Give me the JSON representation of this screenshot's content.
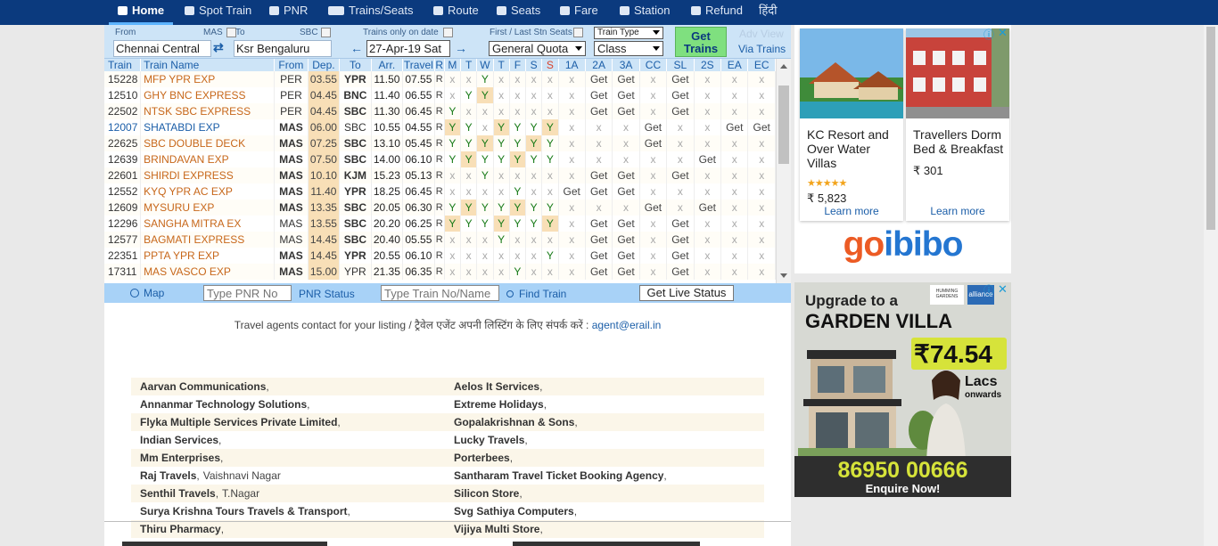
{
  "nav": {
    "items": [
      {
        "label": "Home",
        "icon": "home-icon"
      },
      {
        "label": "Spot Train",
        "icon": "train-icon"
      },
      {
        "label": "PNR",
        "icon": "pnr-icon"
      },
      {
        "label": "Trains/Seats",
        "icon": "seats-icon"
      },
      {
        "label": "Route",
        "icon": "route-icon"
      },
      {
        "label": "Seats",
        "icon": "people-icon"
      },
      {
        "label": "Fare",
        "icon": "tag-icon"
      },
      {
        "label": "Station",
        "icon": "station-icon"
      },
      {
        "label": "Refund",
        "icon": "refund-icon"
      },
      {
        "label": "हिंदी",
        "icon": ""
      }
    ],
    "active": "Home"
  },
  "search": {
    "from_label": "From",
    "from_mas": "MAS",
    "from_value": "Chennai Central",
    "to_label": "To",
    "to_sbc": "SBC",
    "to_value": "Ksr Bengaluru",
    "date_label": "Trains only on date",
    "date_value": "27-Apr-19 Sat",
    "quota_label": "First / Last Stn Seats",
    "quota_value": "General Quota",
    "train_type": "Train Type",
    "class_value": "Class",
    "get_trains": "Get Trains",
    "adv_view": "Adv View",
    "via_trains": "Via Trains"
  },
  "table": {
    "headers": [
      "Train",
      "Train Name",
      "From",
      "Dep.",
      "To",
      "Arr.",
      "Travel",
      "R",
      "M",
      "T",
      "W",
      "T",
      "F",
      "S",
      "S",
      "1A",
      "2A",
      "3A",
      "CC",
      "SL",
      "2S",
      "EA",
      "EC"
    ],
    "rows": [
      {
        "no": "15228",
        "name": "MFP YPR EXP",
        "from": "PER",
        "dep": "03.55",
        "to": "YPR",
        "arr": "11.50",
        "travel": "07.55",
        "r": "R",
        "days": [
          "x",
          "x",
          "Y",
          "x",
          "x",
          "x",
          "x"
        ],
        "cls": [
          "x",
          "Get",
          "Get",
          "x",
          "Get",
          "x",
          "x",
          "x"
        ],
        "blue": false,
        "fromBold": false,
        "toBold": true
      },
      {
        "no": "12510",
        "name": "GHY BNC EXPRESS",
        "from": "PER",
        "dep": "04.45",
        "to": "BNC",
        "arr": "11.40",
        "travel": "06.55",
        "r": "R",
        "days": [
          "x",
          "Y",
          "Y",
          "x",
          "x",
          "x",
          "x"
        ],
        "cls": [
          "x",
          "Get",
          "Get",
          "x",
          "Get",
          "x",
          "x",
          "x"
        ],
        "blue": false,
        "fromBold": false,
        "toBold": true
      },
      {
        "no": "22502",
        "name": "NTSK SBC EXPRESS",
        "from": "PER",
        "dep": "04.45",
        "to": "SBC",
        "arr": "11.30",
        "travel": "06.45",
        "r": "R",
        "days": [
          "Y",
          "x",
          "x",
          "x",
          "x",
          "x",
          "x"
        ],
        "cls": [
          "x",
          "Get",
          "Get",
          "x",
          "Get",
          "x",
          "x",
          "x"
        ],
        "blue": false,
        "fromBold": false,
        "toBold": true
      },
      {
        "no": "12007",
        "name": "SHATABDI EXP",
        "from": "MAS",
        "dep": "06.00",
        "to": "SBC",
        "arr": "10.55",
        "travel": "04.55",
        "r": "R",
        "days": [
          "Y",
          "Y",
          "x",
          "Y",
          "Y",
          "Y",
          "Y"
        ],
        "cls": [
          "x",
          "x",
          "x",
          "Get",
          "x",
          "x",
          "Get",
          "Get"
        ],
        "blue": true,
        "fromBold": true,
        "toBold": false
      },
      {
        "no": "22625",
        "name": "SBC DOUBLE DECK",
        "from": "MAS",
        "dep": "07.25",
        "to": "SBC",
        "arr": "13.10",
        "travel": "05.45",
        "r": "R",
        "days": [
          "Y",
          "Y",
          "Y",
          "Y",
          "Y",
          "Y",
          "Y"
        ],
        "cls": [
          "x",
          "x",
          "x",
          "Get",
          "x",
          "x",
          "x",
          "x"
        ],
        "blue": false,
        "fromBold": true,
        "toBold": true
      },
      {
        "no": "12639",
        "name": "BRINDAVAN EXP",
        "from": "MAS",
        "dep": "07.50",
        "to": "SBC",
        "arr": "14.00",
        "travel": "06.10",
        "r": "R",
        "days": [
          "Y",
          "Y",
          "Y",
          "Y",
          "Y",
          "Y",
          "Y"
        ],
        "cls": [
          "x",
          "x",
          "x",
          "x",
          "x",
          "Get",
          "x",
          "x"
        ],
        "blue": false,
        "fromBold": true,
        "toBold": true
      },
      {
        "no": "22601",
        "name": "SHIRDI EXPRESS",
        "from": "MAS",
        "dep": "10.10",
        "to": "KJM",
        "arr": "15.23",
        "travel": "05.13",
        "r": "R",
        "days": [
          "x",
          "x",
          "Y",
          "x",
          "x",
          "x",
          "x"
        ],
        "cls": [
          "x",
          "Get",
          "Get",
          "x",
          "Get",
          "x",
          "x",
          "x"
        ],
        "blue": false,
        "fromBold": true,
        "toBold": true
      },
      {
        "no": "12552",
        "name": "KYQ YPR AC EXP",
        "from": "MAS",
        "dep": "11.40",
        "to": "YPR",
        "arr": "18.25",
        "travel": "06.45",
        "r": "R",
        "days": [
          "x",
          "x",
          "x",
          "x",
          "Y",
          "x",
          "x"
        ],
        "cls": [
          "Get",
          "Get",
          "Get",
          "x",
          "x",
          "x",
          "x",
          "x"
        ],
        "blue": false,
        "fromBold": true,
        "toBold": true
      },
      {
        "no": "12609",
        "name": "MYSURU EXP",
        "from": "MAS",
        "dep": "13.35",
        "to": "SBC",
        "arr": "20.05",
        "travel": "06.30",
        "r": "R",
        "days": [
          "Y",
          "Y",
          "Y",
          "Y",
          "Y",
          "Y",
          "Y"
        ],
        "cls": [
          "x",
          "x",
          "x",
          "Get",
          "x",
          "Get",
          "x",
          "x"
        ],
        "blue": false,
        "fromBold": true,
        "toBold": true
      },
      {
        "no": "12296",
        "name": "SANGHA MITRA EX",
        "from": "MAS",
        "dep": "13.55",
        "to": "SBC",
        "arr": "20.20",
        "travel": "06.25",
        "r": "R",
        "days": [
          "Y",
          "Y",
          "Y",
          "Y",
          "Y",
          "Y",
          "Y"
        ],
        "cls": [
          "x",
          "Get",
          "Get",
          "x",
          "Get",
          "x",
          "x",
          "x"
        ],
        "blue": false,
        "fromBold": false,
        "toBold": true
      },
      {
        "no": "12577",
        "name": "BAGMATI EXPRESS",
        "from": "MAS",
        "dep": "14.45",
        "to": "SBC",
        "arr": "20.40",
        "travel": "05.55",
        "r": "R",
        "days": [
          "x",
          "x",
          "x",
          "Y",
          "x",
          "x",
          "x"
        ],
        "cls": [
          "x",
          "Get",
          "Get",
          "x",
          "Get",
          "x",
          "x",
          "x"
        ],
        "blue": false,
        "fromBold": false,
        "toBold": true
      },
      {
        "no": "22351",
        "name": "PPTA YPR EXP",
        "from": "MAS",
        "dep": "14.45",
        "to": "YPR",
        "arr": "20.55",
        "travel": "06.10",
        "r": "R",
        "days": [
          "x",
          "x",
          "x",
          "x",
          "x",
          "x",
          "Y"
        ],
        "cls": [
          "x",
          "Get",
          "Get",
          "x",
          "Get",
          "x",
          "x",
          "x"
        ],
        "blue": false,
        "fromBold": true,
        "toBold": true
      },
      {
        "no": "17311",
        "name": "MAS VASCO EXP",
        "from": "MAS",
        "dep": "15.00",
        "to": "YPR",
        "arr": "21.35",
        "travel": "06.35",
        "r": "R",
        "days": [
          "x",
          "x",
          "x",
          "x",
          "Y",
          "x",
          "x"
        ],
        "cls": [
          "x",
          "Get",
          "Get",
          "x",
          "Get",
          "x",
          "x",
          "x"
        ],
        "blue": false,
        "fromBold": true,
        "toBold": false
      }
    ]
  },
  "bar2": {
    "map": "Map",
    "pnr_placeholder": "Type PNR No",
    "pnr_status": "PNR Status",
    "train_placeholder": "Type Train No/Name",
    "find_train": "Find Train",
    "live_status": "Get Live Status"
  },
  "agents": {
    "contact_text": "Travel agents contact for your listing / ट्रैवेल एजेंट अपनी लिस्टिंग के लिए संपर्क करें :",
    "contact_email": "agent@erail.in",
    "rows": [
      [
        {
          "name": "Aarvan Communications",
          "loc": ""
        },
        {
          "name": "Aelos It Services",
          "loc": ""
        }
      ],
      [
        {
          "name": "Annanmar Technology Solutions",
          "loc": ""
        },
        {
          "name": "Extreme Holidays",
          "loc": ""
        }
      ],
      [
        {
          "name": "Flyka Multiple Services Private Limited",
          "loc": ""
        },
        {
          "name": "Gopalakrishnan & Sons",
          "loc": ""
        }
      ],
      [
        {
          "name": "Indian Services",
          "loc": ""
        },
        {
          "name": "Lucky Travels",
          "loc": ""
        }
      ],
      [
        {
          "name": "Mm Enterprises",
          "loc": ""
        },
        {
          "name": "Porterbees",
          "loc": ""
        }
      ],
      [
        {
          "name": "Raj Travels",
          "loc": "Vaishnavi Nagar"
        },
        {
          "name": "Santharam Travel Ticket Booking Agency",
          "loc": ""
        }
      ],
      [
        {
          "name": "Senthil Travels",
          "loc": "T.Nagar"
        },
        {
          "name": "Silicon Store",
          "loc": ""
        }
      ],
      [
        {
          "name": "Surya Krishna Tours Travels & Transport",
          "loc": ""
        },
        {
          "name": "Svg Sathiya Computers",
          "loc": ""
        }
      ],
      [
        {
          "name": "Thiru Pharmacy",
          "loc": ""
        },
        {
          "name": "Vijiya Multi Store",
          "loc": ""
        }
      ]
    ]
  },
  "ad1": {
    "cards": [
      {
        "name": "KC Resort and Over Water Villas",
        "stars": "★★★★★",
        "price": "₹ 5,823",
        "learn": "Learn more"
      },
      {
        "name": "Travellers Dorm Bed & Breakfast",
        "stars": "",
        "price": "₹ 301",
        "learn": "Learn more"
      }
    ],
    "logo_a": "go",
    "logo_b": "ibibo"
  },
  "ad2": {
    "headline1": "Upgrade to a",
    "headline2": "GARDEN VILLA",
    "price": "₹74.54",
    "price_unit": "Lacs",
    "price_sub": "onwards",
    "phone": "86950 00666",
    "cta": "Enquire Now!",
    "brand": "HUMMING GARDENS",
    "brand2": "alliance"
  },
  "colors": {
    "nav": "#0b3a7e",
    "header": "#cde4f7",
    "orange": "#c7671a",
    "green": "#177a17",
    "get_trains": "#7fe07f"
  }
}
